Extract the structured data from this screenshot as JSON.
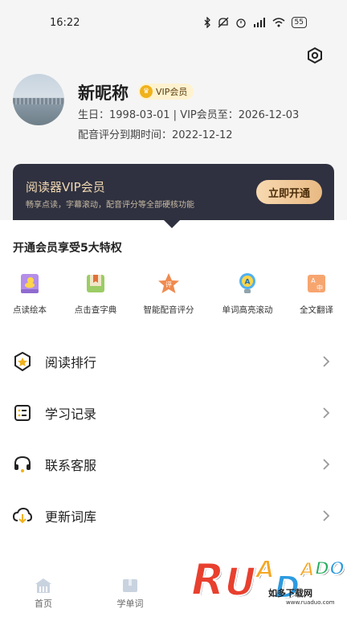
{
  "status_bar": {
    "time": "16:22",
    "battery": "55"
  },
  "profile": {
    "nickname": "新昵称",
    "vip_badge": "VIP会员",
    "birthday_line": "生日：1998-03-01 | VIP会员至：2026-12-03",
    "dubbing_line": "配音评分到期时间：2022-12-12"
  },
  "vip_card": {
    "title": "阅读器VIP会员",
    "subtitle": "畅享点读，字幕滚动，配音评分等全部硬核功能",
    "button": "立即开通"
  },
  "privileges": {
    "title": "开通会员享受5大特权",
    "items": [
      {
        "label": "点读绘本",
        "icon": "duck-book-icon",
        "color": "#b48ee8"
      },
      {
        "label": "点击查字典",
        "icon": "dictionary-icon",
        "color": "#8bc34a"
      },
      {
        "label": "智能配音评分",
        "icon": "star-rating-icon",
        "color": "#ef8a4f"
      },
      {
        "label": "单词高亮滚动",
        "icon": "lightbulb-a-icon",
        "color": "#4fb0f0"
      },
      {
        "label": "全文翻译",
        "icon": "translate-icon",
        "color": "#f28c52"
      }
    ]
  },
  "menu": [
    {
      "label": "阅读排行",
      "icon": "ranking-badge-icon"
    },
    {
      "label": "学习记录",
      "icon": "record-list-icon"
    },
    {
      "label": "联系客服",
      "icon": "headset-icon"
    },
    {
      "label": "更新词库",
      "icon": "cloud-download-icon"
    }
  ],
  "bottom_nav": [
    {
      "label": "首页",
      "icon": "home-icon"
    },
    {
      "label": "学单词",
      "icon": "word-book-icon"
    }
  ],
  "watermark": {
    "letters": "RUANDADO",
    "subtitle": "如多下载网",
    "url": "www.ruaduo.com"
  },
  "colors": {
    "accent_gold": "#f0b21c",
    "vip_card_bg": "#2f3140",
    "vip_text": "#f1d8b1"
  }
}
